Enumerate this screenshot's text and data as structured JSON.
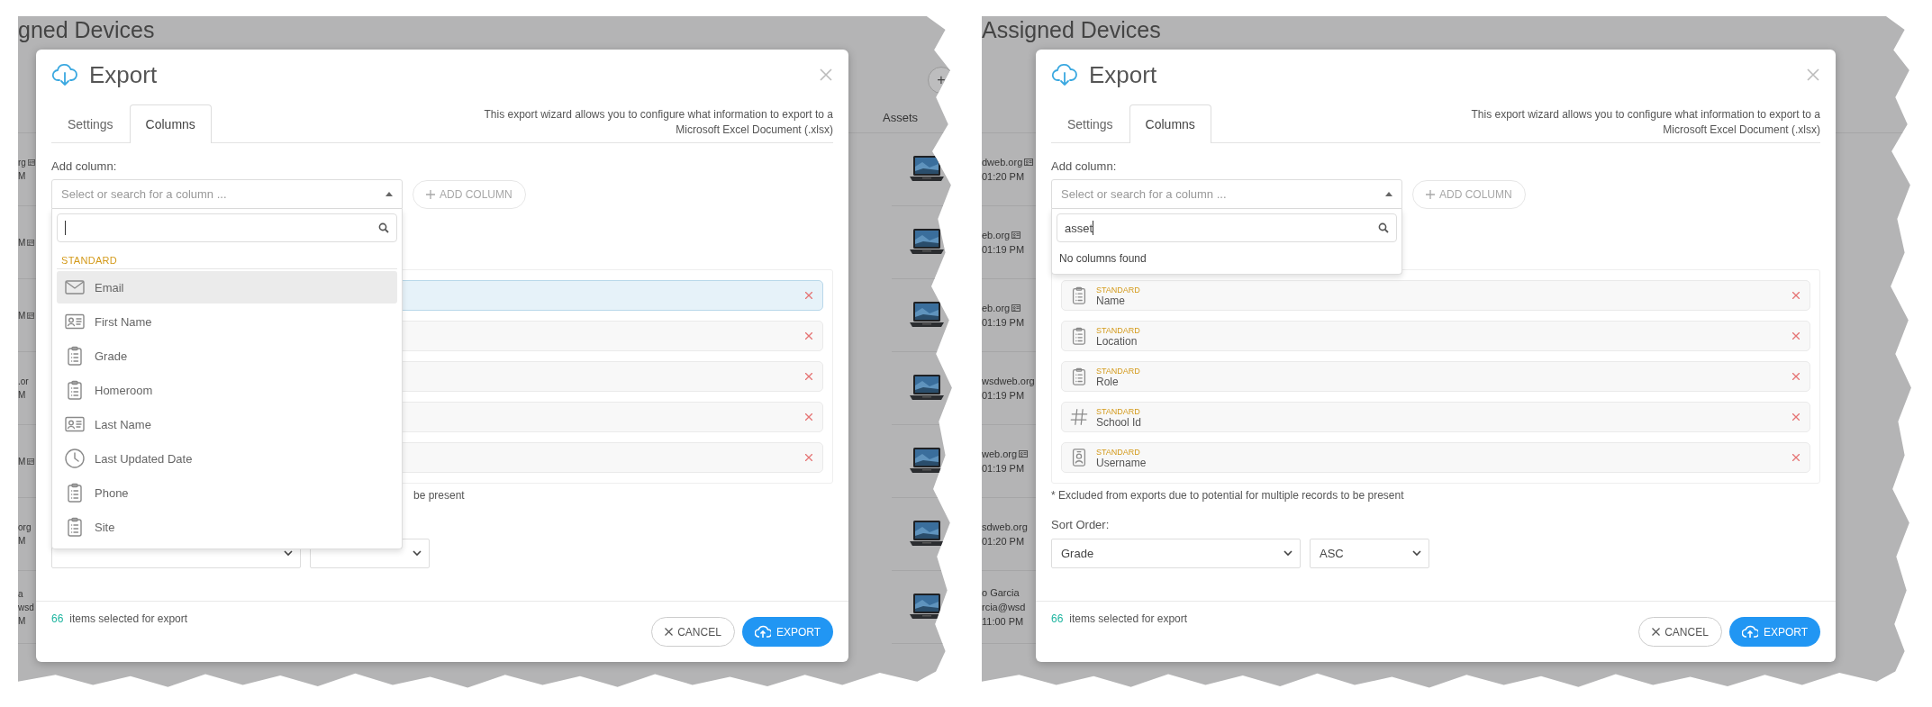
{
  "panels": [
    {
      "page_title": "gned Devices",
      "header_button": "+",
      "assets_header": "Assets",
      "side_rows": [
        {
          "lines": [
            "rg",
            "M"
          ],
          "card_icon": true
        },
        {
          "lines": [
            "M"
          ],
          "card_icon": true
        },
        {
          "lines": [
            "M"
          ],
          "card_icon": true
        },
        {
          "lines": [
            ".or",
            "M"
          ],
          "card_icon": false
        },
        {
          "lines": [
            "M"
          ],
          "card_icon": true
        },
        {
          "lines": [
            "org",
            "M"
          ],
          "card_icon": false
        },
        {
          "lines": [
            "a",
            "wsd",
            "M"
          ],
          "card_icon": false
        }
      ],
      "assets": [
        {
          "kind": "picture"
        },
        {
          "kind": "picture"
        },
        {
          "kind": "picture"
        },
        {
          "kind": "picture"
        },
        {
          "kind": "picture"
        },
        {
          "kind": "picture"
        },
        {
          "kind": "picture"
        }
      ],
      "dialog": {
        "title": "Export",
        "tabs": [
          {
            "label": "Settings",
            "selected": false
          },
          {
            "label": "Columns",
            "selected": true
          }
        ],
        "description": "This export wizard allows you to configure what information to export to a Microsoft Excel Document (.xlsx)",
        "add_column_label": "Add column:",
        "column_select": {
          "placeholder": "Select or search for a column ...",
          "expanded": true
        },
        "add_column_button": {
          "label": "ADD COLUMN",
          "disabled": true
        },
        "dropdown": {
          "group": "STANDARD",
          "options": [
            {
              "label": "Email",
              "kind": "envelope",
              "highlighted": true
            },
            {
              "label": "First Name",
              "kind": "id-card",
              "highlighted": false
            },
            {
              "label": "Grade",
              "kind": "clipboard",
              "highlighted": false
            },
            {
              "label": "Homeroom",
              "kind": "clipboard",
              "highlighted": false
            },
            {
              "label": "Last Name",
              "kind": "id-card",
              "highlighted": false
            },
            {
              "label": "Last Updated Date",
              "kind": "clock",
              "highlighted": false
            },
            {
              "label": "Phone",
              "kind": "clipboard",
              "highlighted": false
            },
            {
              "label": "Site",
              "kind": "clipboard",
              "highlighted": false
            }
          ]
        },
        "columns": [
          {
            "highlighted": true
          },
          {
            "highlighted": false
          },
          {
            "highlighted": false
          },
          {
            "highlighted": false
          },
          {
            "highlighted": false
          }
        ],
        "footnote": "be present",
        "selected_count": "66",
        "selected_text": "items selected for export",
        "cancel_label": "CANCEL",
        "export_label": "EXPORT"
      }
    },
    {
      "page_title": "Assigned Devices",
      "side_rows": [
        {
          "lines": [
            "dweb.org",
            "01:20 PM"
          ],
          "card_icon": true
        },
        {
          "lines": [
            "eb.org",
            "01:19 PM"
          ],
          "card_icon": true
        },
        {
          "lines": [
            "eb.org",
            "01:19 PM"
          ],
          "card_icon": true
        },
        {
          "lines": [
            "wsdweb.org",
            "01:19 PM"
          ],
          "card_icon": false
        },
        {
          "lines": [
            "web.org",
            "01:19 PM"
          ],
          "card_icon": true
        },
        {
          "lines": [
            "sdweb.org",
            "01:20 PM"
          ],
          "card_icon": false
        },
        {
          "lines": [
            "o Garcia",
            "rcia@wsd",
            "11:00 PM"
          ],
          "card_icon": false
        }
      ],
      "dialog": {
        "title": "Export",
        "tabs": [
          {
            "label": "Settings",
            "selected": false
          },
          {
            "label": "Columns",
            "selected": true
          }
        ],
        "description": "This export wizard allows you to configure what information to export to a Microsoft Excel Document (.xlsx)",
        "add_column_label": "Add column:",
        "column_select": {
          "placeholder": "Select or search for a column ...",
          "expanded": true
        },
        "add_column_button": {
          "label": "ADD COLUMN",
          "disabled": true
        },
        "dropdown": {
          "search_value": "asset",
          "empty_message": "No columns found"
        },
        "columns": [
          {
            "group": "STANDARD",
            "label": "Name",
            "kind": "clipboard",
            "highlighted": false
          },
          {
            "group": "STANDARD",
            "label": "Location",
            "kind": "clipboard",
            "highlighted": false
          },
          {
            "group": "STANDARD",
            "label": "Role",
            "kind": "clipboard",
            "highlighted": false
          },
          {
            "group": "STANDARD",
            "label": "School Id",
            "kind": "hash",
            "highlighted": false
          },
          {
            "group": "STANDARD",
            "label": "Username",
            "kind": "badge",
            "highlighted": false
          }
        ],
        "footnote": "* Excluded from exports due to potential for multiple records to be present",
        "sort_label": "Sort Order:",
        "sort_field": "Grade",
        "sort_direction": "ASC",
        "selected_count": "66",
        "selected_text": "items selected for export",
        "cancel_label": "CANCEL",
        "export_label": "EXPORT"
      }
    }
  ]
}
